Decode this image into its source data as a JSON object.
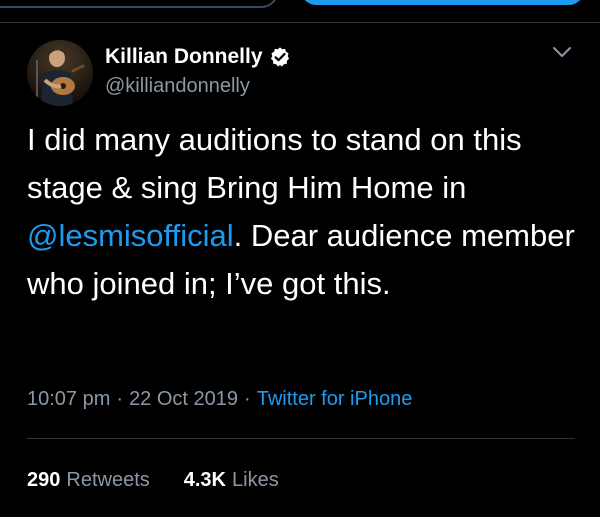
{
  "tweet": {
    "author": {
      "name": "Killian Donnelly",
      "handle": "@killiandonnelly",
      "verified": true
    },
    "text_parts": {
      "before_mention": "I did many auditions to stand on this stage & sing Bring Him Home in ",
      "mention": "@lesmisofficial",
      "after_mention": ". Dear audience member who joined in; I’ve got this."
    },
    "time": "10:07 pm",
    "date": "22 Oct 2019",
    "separator": "·",
    "source": "Twitter for iPhone",
    "stats": {
      "retweets_count": "290",
      "retweets_label": "Retweets",
      "likes_count": "4.3K",
      "likes_label": "Likes"
    }
  },
  "icons": {
    "verified": "verified-badge-icon",
    "menu": "chevron-down-icon"
  },
  "colors": {
    "background": "#000000",
    "text": "#ffffff",
    "secondary_text": "#8b98a5",
    "accent": "#1d9bf0",
    "divider": "#2f3336"
  }
}
